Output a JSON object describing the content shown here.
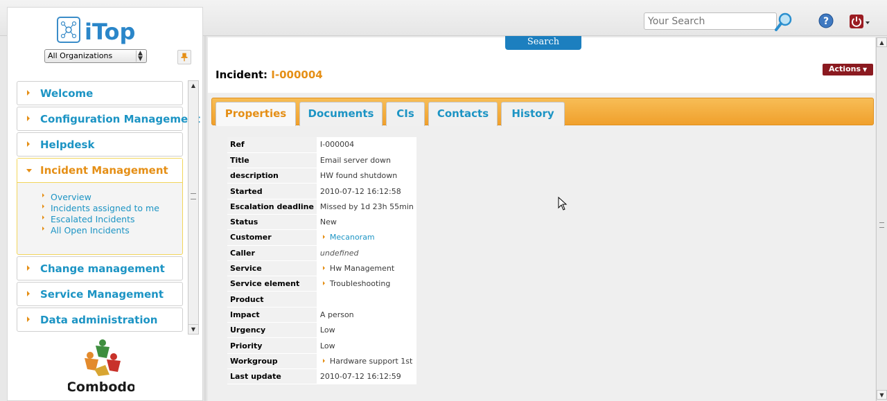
{
  "header": {
    "search_placeholder": "Your Search",
    "search_value": ""
  },
  "sidebar": {
    "logo_text": "iTop",
    "org_select": "All Organizations",
    "menu": [
      {
        "label": "Welcome"
      },
      {
        "label": "Configuration Management"
      },
      {
        "label": "Helpdesk"
      },
      {
        "label": "Incident Management",
        "open": true,
        "items": [
          "Overview",
          "Incidents assigned to me",
          "Escalated Incidents",
          "All Open Incidents"
        ]
      },
      {
        "label": "Change management"
      },
      {
        "label": "Service Management"
      },
      {
        "label": "Data administration"
      }
    ],
    "footer_logo_text": "Combodo"
  },
  "main": {
    "search_button": "Search",
    "title_prefix": "Incident: ",
    "title_ref": "I-000004",
    "actions_label": "Actions",
    "tabs": [
      {
        "label": "Properties",
        "active": true
      },
      {
        "label": "Documents"
      },
      {
        "label": "CIs"
      },
      {
        "label": "Contacts"
      },
      {
        "label": "History"
      }
    ],
    "properties": [
      {
        "key": "Ref",
        "value": "I-000004"
      },
      {
        "key": "Title",
        "value": "Email server down"
      },
      {
        "key": "description",
        "value": "HW found shutdown"
      },
      {
        "key": "Started",
        "value": "2010-07-12 16:12:58"
      },
      {
        "key": "Escalation deadline",
        "value": "Missed by 1d 23h 55min"
      },
      {
        "key": "Status",
        "value": "New"
      },
      {
        "key": "Customer",
        "value": "Mecanoram"
      },
      {
        "key": "Caller",
        "value": "undefined"
      },
      {
        "key": "Service",
        "value": "Hw Management"
      },
      {
        "key": "Service element",
        "value": "Troubleshooting"
      },
      {
        "key": "Product",
        "value": ""
      },
      {
        "key": "Impact",
        "value": "A person"
      },
      {
        "key": "Urgency",
        "value": "Low"
      },
      {
        "key": "Priority",
        "value": "Low"
      },
      {
        "key": "Workgroup",
        "value": "Hardware support 1st"
      },
      {
        "key": "Last update",
        "value": "2010-07-12 16:12:59"
      }
    ]
  },
  "colors": {
    "accent_orange": "#e58f16",
    "link_blue": "#1c94c4",
    "actions_red": "#8b1a20"
  }
}
